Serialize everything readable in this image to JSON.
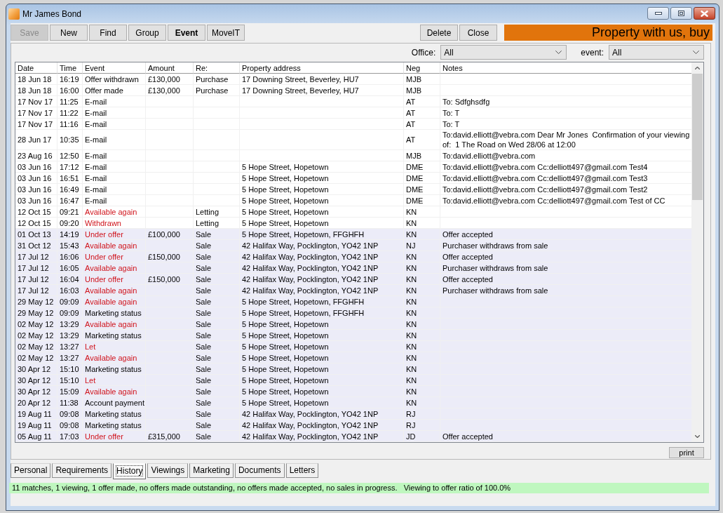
{
  "window": {
    "title": "Mr James Bond"
  },
  "toolbar": [
    {
      "label": "Save",
      "disabled": true,
      "selected": false
    },
    {
      "label": "New",
      "disabled": false,
      "selected": false
    },
    {
      "label": "Find",
      "disabled": false,
      "selected": false
    },
    {
      "label": "Group",
      "disabled": false,
      "selected": false
    },
    {
      "label": "Event",
      "disabled": false,
      "selected": true
    },
    {
      "label": "MoveIT",
      "disabled": false,
      "selected": false
    }
  ],
  "actions": [
    "Delete",
    "Close"
  ],
  "banner": "Property with us, buy",
  "filters": [
    {
      "label": "Office:",
      "value": "All"
    },
    {
      "label": "event:",
      "value": "All"
    }
  ],
  "table": {
    "columns": [
      "Date",
      "Time",
      "Event",
      "Amount",
      "Re:",
      "Property address",
      "Neg",
      "Notes"
    ],
    "rows": [
      {
        "date": "18 Jun 18",
        "time": "16:19",
        "event": "Offer withdrawn",
        "amount": "£130,000",
        "re": "Purchase",
        "property_address": "17 Downing Street, Beverley, HU7",
        "neg": "MJB",
        "flagged": false,
        "shaded": false
      },
      {
        "date": "18 Jun 18",
        "time": "16:00",
        "event": "Offer made",
        "amount": "£130,000",
        "re": "Purchase",
        "property_address": "17 Downing Street, Beverley, HU7",
        "neg": "MJB",
        "flagged": false,
        "shaded": false
      },
      {
        "date": "17 Nov 17",
        "time": "11:25",
        "event": "E-mail",
        "neg": "AT",
        "notes": "To: Sdfghsdfg",
        "flagged": false,
        "shaded": false
      },
      {
        "date": "17 Nov 17",
        "time": "11:22",
        "event": "E-mail",
        "neg": "AT",
        "notes": "To: T",
        "flagged": false,
        "shaded": false
      },
      {
        "date": "17 Nov 17",
        "time": "11:16",
        "event": "E-mail",
        "neg": "AT",
        "notes": "To: T",
        "flagged": false,
        "shaded": false
      },
      {
        "date": "28 Jun 17",
        "time": "10:35",
        "event": "E-mail",
        "neg": "AT",
        "notes": "To:david.elliott@vebra.com Dear Mr Jones  Confirmation of your viewing of:  1 The Road on Wed 28/06 at 12:00",
        "flagged": false,
        "shaded": false
      },
      {
        "date": "23 Aug 16",
        "time": "12:50",
        "event": "E-mail",
        "neg": "MJB",
        "notes": "To:david.elliott@vebra.com",
        "flagged": false,
        "shaded": false
      },
      {
        "date": "03 Jun 16",
        "time": "17:12",
        "event": "E-mail",
        "property_address": "5 Hope Street, Hopetown",
        "neg": "DME",
        "notes": "To:david.elliott@vebra.com Cc:delliott497@gmail.com Test4",
        "flagged": false,
        "shaded": false
      },
      {
        "date": "03 Jun 16",
        "time": "16:51",
        "event": "E-mail",
        "property_address": "5 Hope Street, Hopetown",
        "neg": "DME",
        "notes": "To:david.elliott@vebra.com Cc:delliott497@gmail.com Test3",
        "flagged": false,
        "shaded": false
      },
      {
        "date": "03 Jun 16",
        "time": "16:49",
        "event": "E-mail",
        "property_address": "5 Hope Street, Hopetown",
        "neg": "DME",
        "notes": "To:david.elliott@vebra.com Cc:delliott497@gmail.com Test2",
        "flagged": false,
        "shaded": false
      },
      {
        "date": "03 Jun 16",
        "time": "16:47",
        "event": "E-mail",
        "property_address": "5 Hope Street, Hopetown",
        "neg": "DME",
        "notes": "To:david.elliott@vebra.com Cc:delliott497@gmail.com Test of CC",
        "flagged": false,
        "shaded": false
      },
      {
        "date": "12 Oct 15",
        "time": "09:21",
        "event": "Available again",
        "re": "Letting",
        "property_address": "5 Hope Street, Hopetown",
        "neg": "KN",
        "flagged": true,
        "shaded": false
      },
      {
        "date": "12 Oct 15",
        "time": "09:20",
        "event": "Withdrawn",
        "re": "Letting",
        "property_address": "5 Hope Street, Hopetown",
        "neg": "KN",
        "flagged": true,
        "shaded": false
      },
      {
        "date": "01 Oct 13",
        "time": "14:19",
        "event": "Under offer",
        "amount": "£100,000",
        "re": "Sale",
        "property_address": "5 Hope Street, Hopetown, FFGHFH",
        "neg": "KN",
        "notes": "Offer accepted",
        "flagged": true,
        "shaded": true
      },
      {
        "date": "31 Oct 12",
        "time": "15:43",
        "event": "Available again",
        "re": "Sale",
        "property_address": "42 Halifax Way, Pocklington, YO42 1NP",
        "neg": "NJ",
        "notes": "Purchaser withdraws from sale",
        "flagged": true,
        "shaded": true
      },
      {
        "date": "17 Jul 12",
        "time": "16:06",
        "event": "Under offer",
        "amount": "£150,000",
        "re": "Sale",
        "property_address": "42 Halifax Way, Pocklington, YO42 1NP",
        "neg": "KN",
        "notes": "Offer accepted",
        "flagged": true,
        "shaded": true
      },
      {
        "date": "17 Jul 12",
        "time": "16:05",
        "event": "Available again",
        "re": "Sale",
        "property_address": "42 Halifax Way, Pocklington, YO42 1NP",
        "neg": "KN",
        "notes": "Purchaser withdraws from sale",
        "flagged": true,
        "shaded": true
      },
      {
        "date": "17 Jul 12",
        "time": "16:04",
        "event": "Under offer",
        "amount": "£150,000",
        "re": "Sale",
        "property_address": "42 Halifax Way, Pocklington, YO42 1NP",
        "neg": "KN",
        "notes": "Offer accepted",
        "flagged": true,
        "shaded": true
      },
      {
        "date": "17 Jul 12",
        "time": "16:03",
        "event": "Available again",
        "re": "Sale",
        "property_address": "42 Halifax Way, Pocklington, YO42 1NP",
        "neg": "KN",
        "notes": "Purchaser withdraws from sale",
        "flagged": true,
        "shaded": true
      },
      {
        "date": "29 May 12",
        "time": "09:09",
        "event": "Available again",
        "re": "Sale",
        "property_address": "5 Hope Street, Hopetown, FFGHFH",
        "neg": "KN",
        "flagged": true,
        "shaded": true
      },
      {
        "date": "29 May 12",
        "time": "09:09",
        "event": "Marketing status",
        "re": "Sale",
        "property_address": "5 Hope Street, Hopetown, FFGHFH",
        "neg": "KN",
        "flagged": false,
        "shaded": true
      },
      {
        "date": "02 May 12",
        "time": "13:29",
        "event": "Available again",
        "re": "Sale",
        "property_address": "5 Hope Street, Hopetown",
        "neg": "KN",
        "flagged": true,
        "shaded": true
      },
      {
        "date": "02 May 12",
        "time": "13:29",
        "event": "Marketing status",
        "re": "Sale",
        "property_address": "5 Hope Street, Hopetown",
        "neg": "KN",
        "flagged": false,
        "shaded": true
      },
      {
        "date": "02 May 12",
        "time": "13:27",
        "event": "Let",
        "re": "Sale",
        "property_address": "5 Hope Street, Hopetown",
        "neg": "KN",
        "flagged": true,
        "shaded": true
      },
      {
        "date": "02 May 12",
        "time": "13:27",
        "event": "Available again",
        "re": "Sale",
        "property_address": "5 Hope Street, Hopetown",
        "neg": "KN",
        "flagged": true,
        "shaded": true
      },
      {
        "date": "30 Apr 12",
        "time": "15:10",
        "event": "Marketing status",
        "re": "Sale",
        "property_address": "5 Hope Street, Hopetown",
        "neg": "KN",
        "flagged": false,
        "shaded": true
      },
      {
        "date": "30 Apr 12",
        "time": "15:10",
        "event": "Let",
        "re": "Sale",
        "property_address": "5 Hope Street, Hopetown",
        "neg": "KN",
        "flagged": true,
        "shaded": true
      },
      {
        "date": "30 Apr 12",
        "time": "15:09",
        "event": "Available again",
        "re": "Sale",
        "property_address": "5 Hope Street, Hopetown",
        "neg": "KN",
        "flagged": true,
        "shaded": true
      },
      {
        "date": "20 Apr 12",
        "time": "11:38",
        "event": "Account payment",
        "re": "Sale",
        "property_address": "5 Hope Street, Hopetown",
        "neg": "KN",
        "flagged": false,
        "shaded": true
      },
      {
        "date": "19 Aug 11",
        "time": "09:08",
        "event": "Marketing status",
        "re": "Sale",
        "property_address": "42 Halifax Way, Pocklington, YO42 1NP",
        "neg": "RJ",
        "flagged": false,
        "shaded": true
      },
      {
        "date": "19 Aug 11",
        "time": "09:08",
        "event": "Marketing status",
        "re": "Sale",
        "property_address": "42 Halifax Way, Pocklington, YO42 1NP",
        "neg": "RJ",
        "flagged": false,
        "shaded": true
      },
      {
        "date": "05 Aug 11",
        "time": "17:03",
        "event": "Under offer",
        "amount": "£315,000",
        "re": "Sale",
        "property_address": "42 Halifax Way, Pocklington, YO42 1NP",
        "neg": "JD",
        "notes": "Offer accepted",
        "flagged": true,
        "shaded": true
      }
    ]
  },
  "print_button": "print",
  "tabs": [
    {
      "label": "Personal",
      "selected": false
    },
    {
      "label": "Requirements",
      "selected": false
    },
    {
      "label": "History",
      "selected": true
    },
    {
      "label": "Viewings",
      "selected": false
    },
    {
      "label": "Marketing",
      "selected": false
    },
    {
      "label": "Documents",
      "selected": false
    },
    {
      "label": "Letters",
      "selected": false
    }
  ],
  "status_bar": "11 matches, 1 viewing, 1 offer made, no offers made outstanding, no offers made accepted, no sales in progress.   Viewing to offer ratio of 100.0%"
}
